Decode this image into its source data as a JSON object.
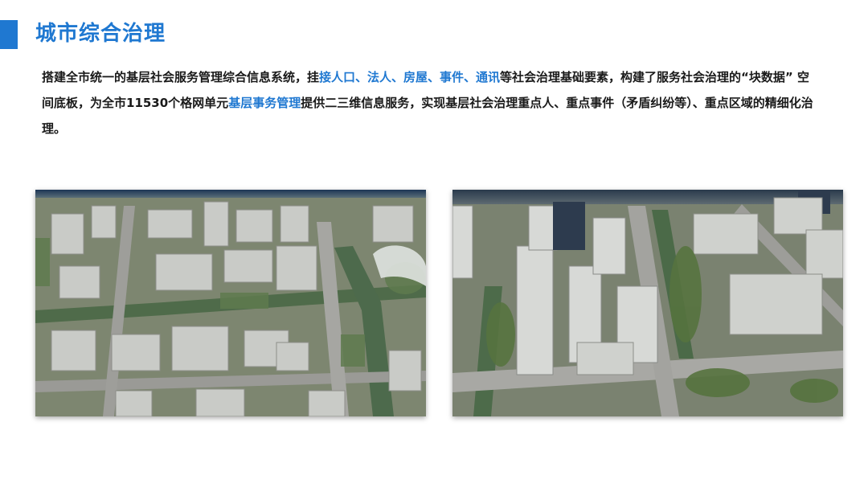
{
  "page": {
    "title": "城市综合治理",
    "paragraph": [
      {
        "text": "搭建全市统一的基层社会服务管理综合信息系统，挂",
        "highlight": false
      },
      {
        "text": "接人口、法人、房屋、事件、通讯",
        "highlight": true
      },
      {
        "text": "等社会治理基础要素，构建了服务社会治理的“块数据” 空间底板，为全市11530个格网单元",
        "highlight": false
      },
      {
        "text": "基层事务管理",
        "highlight": true
      },
      {
        "text": "提供二三维信息服务，实现基层社会治理重点人、重点事件（矛盾纠纷等）、重点区域的精细化治理。",
        "highlight": false
      }
    ],
    "colors": {
      "accent": "#1f78d1",
      "text": "#1a1a1a"
    }
  },
  "images": [
    {
      "name": "aerial-city-view-left"
    },
    {
      "name": "aerial-city-view-right"
    }
  ]
}
